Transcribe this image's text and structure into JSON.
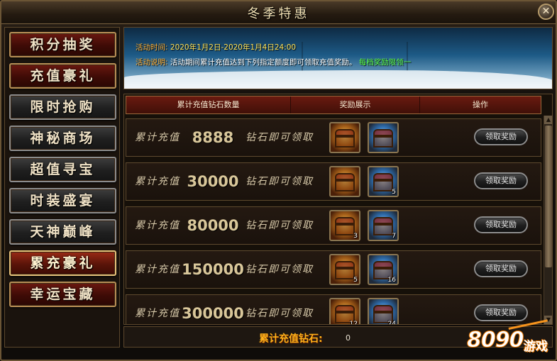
{
  "window": {
    "title": "冬季特惠",
    "close_label": "✕"
  },
  "sidebar": {
    "items": [
      {
        "label": "积分抽奖",
        "style": "red"
      },
      {
        "label": "充值豪礼",
        "style": "red"
      },
      {
        "label": "限时抢购",
        "style": "plain"
      },
      {
        "label": "神秘商场",
        "style": "plain"
      },
      {
        "label": "超值寻宝",
        "style": "plain"
      },
      {
        "label": "时装盛宴",
        "style": "plain"
      },
      {
        "label": "天神巅峰",
        "style": "plain"
      },
      {
        "label": "累充豪礼",
        "style": "active"
      },
      {
        "label": "幸运宝藏",
        "style": "red"
      }
    ]
  },
  "banner": {
    "time_label": "活动时间:",
    "time_value": "2020年1月2日-2020年1月4日24:00",
    "desc_label": "活动说明:",
    "desc_text": "活动期间累计充值达到下列指定额度即可领取充值奖励。",
    "desc_highlight": "每档奖励限领一"
  },
  "table": {
    "headers": [
      "累计充值钻石数量",
      "奖励展示",
      "操作"
    ],
    "row_prefix": "累计充值",
    "row_suffix": "钻石即可领取",
    "claim_label": "领取奖励",
    "rows": [
      {
        "amount": "8888",
        "rewards": [
          {
            "type": "gold",
            "count": ""
          },
          {
            "type": "blue",
            "count": ""
          }
        ]
      },
      {
        "amount": "30000",
        "rewards": [
          {
            "type": "gold",
            "count": ""
          },
          {
            "type": "blue",
            "count": "5"
          }
        ]
      },
      {
        "amount": "80000",
        "rewards": [
          {
            "type": "gold",
            "count": "3"
          },
          {
            "type": "blue",
            "count": "7"
          }
        ]
      },
      {
        "amount": "150000",
        "rewards": [
          {
            "type": "gold",
            "count": "5"
          },
          {
            "type": "blue",
            "count": "16"
          }
        ]
      },
      {
        "amount": "300000",
        "rewards": [
          {
            "type": "gold",
            "count": "12"
          },
          {
            "type": "blue",
            "count": "24"
          }
        ]
      }
    ]
  },
  "footer": {
    "label": "累计充值钻石:",
    "value": "0"
  },
  "watermark": {
    "digits": "8090",
    "text": "游戏"
  },
  "colors": {
    "accent_gold": "#ffb21a",
    "highlight_green": "#5cff4a",
    "frame": "#6b5535"
  }
}
